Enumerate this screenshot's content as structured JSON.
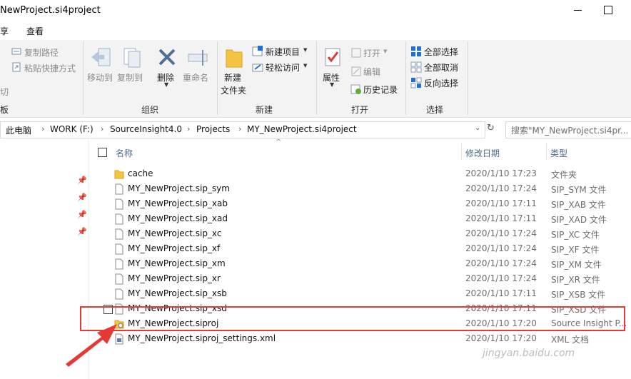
{
  "window": {
    "title": "NewProject.si4project"
  },
  "menu": {
    "tabs": [
      "享",
      "查看"
    ]
  },
  "ribbon": {
    "clipboard": {
      "copy_path": "复制路径",
      "paste_shortcut": "粘贴快捷方式",
      "cut_partial": "切",
      "board_partial": "板"
    },
    "organize": {
      "move_to": "移动到",
      "copy_to": "复制到",
      "delete": "删除",
      "rename": "重命名",
      "group": "组织"
    },
    "new": {
      "new_folder_line1": "新建",
      "new_folder_line2": "文件夹",
      "new_item": "新建项目",
      "easy_access": "轻松访问",
      "group": "新建"
    },
    "open": {
      "properties": "属性",
      "open": "打开",
      "edit": "编辑",
      "history": "历史记录",
      "group": "打开"
    },
    "select": {
      "select_all": "全部选择",
      "select_none": "全部取消",
      "invert": "反向选择",
      "group": "选择"
    }
  },
  "address": {
    "crumbs": [
      "此电脑",
      "WORK (F:)",
      "SourceInsight4.0",
      "Projects",
      "MY_NewProject.si4project"
    ],
    "search_placeholder": "搜索\"MY_NewProject.si4pr..."
  },
  "list": {
    "columns": {
      "name": "名称",
      "date": "修改日期",
      "type": "类型"
    },
    "rows": [
      {
        "name": "cache",
        "date": "2020/1/10 17:23",
        "type": "文件夹",
        "icon": "folder-icon"
      },
      {
        "name": "MY_NewProject.sip_sym",
        "date": "2020/1/10 17:24",
        "type": "SIP_SYM 文件",
        "icon": "file-icon"
      },
      {
        "name": "MY_NewProject.sip_xab",
        "date": "2020/1/10 17:11",
        "type": "SIP_XAB 文件",
        "icon": "file-icon"
      },
      {
        "name": "MY_NewProject.sip_xad",
        "date": "2020/1/10 17:11",
        "type": "SIP_XAD 文件",
        "icon": "file-icon"
      },
      {
        "name": "MY_NewProject.sip_xc",
        "date": "2020/1/10 17:24",
        "type": "SIP_XC 文件",
        "icon": "file-icon"
      },
      {
        "name": "MY_NewProject.sip_xf",
        "date": "2020/1/10 17:24",
        "type": "SIP_XF 文件",
        "icon": "file-icon"
      },
      {
        "name": "MY_NewProject.sip_xm",
        "date": "2020/1/10 17:24",
        "type": "SIP_XM 文件",
        "icon": "file-icon"
      },
      {
        "name": "MY_NewProject.sip_xr",
        "date": "2020/1/10 17:24",
        "type": "SIP_XR 文件",
        "icon": "file-icon"
      },
      {
        "name": "MY_NewProject.sip_xsb",
        "date": "2020/1/10 17:11",
        "type": "SIP_XSB 文件",
        "icon": "file-icon"
      },
      {
        "name": "MY_NewProject.sip_xsd",
        "date": "2020/1/10 17:11",
        "type": "SIP_XSD 文件",
        "icon": "file-icon"
      },
      {
        "name": "MY_NewProject.siproj",
        "date": "2020/1/10 17:20",
        "type": "Source Insight P...",
        "icon": "siproj-icon"
      },
      {
        "name": "MY_NewProject.siproj_settings.xml",
        "date": "2020/1/10 17:20",
        "type": "XML 文档",
        "icon": "xml-file-icon"
      }
    ]
  },
  "watermark": "jingyan.baidu.com",
  "colors": {
    "highlight": "#e53935",
    "arrow": "#e53935",
    "folder": "#f4c542",
    "accent": "#1e6fd9"
  }
}
